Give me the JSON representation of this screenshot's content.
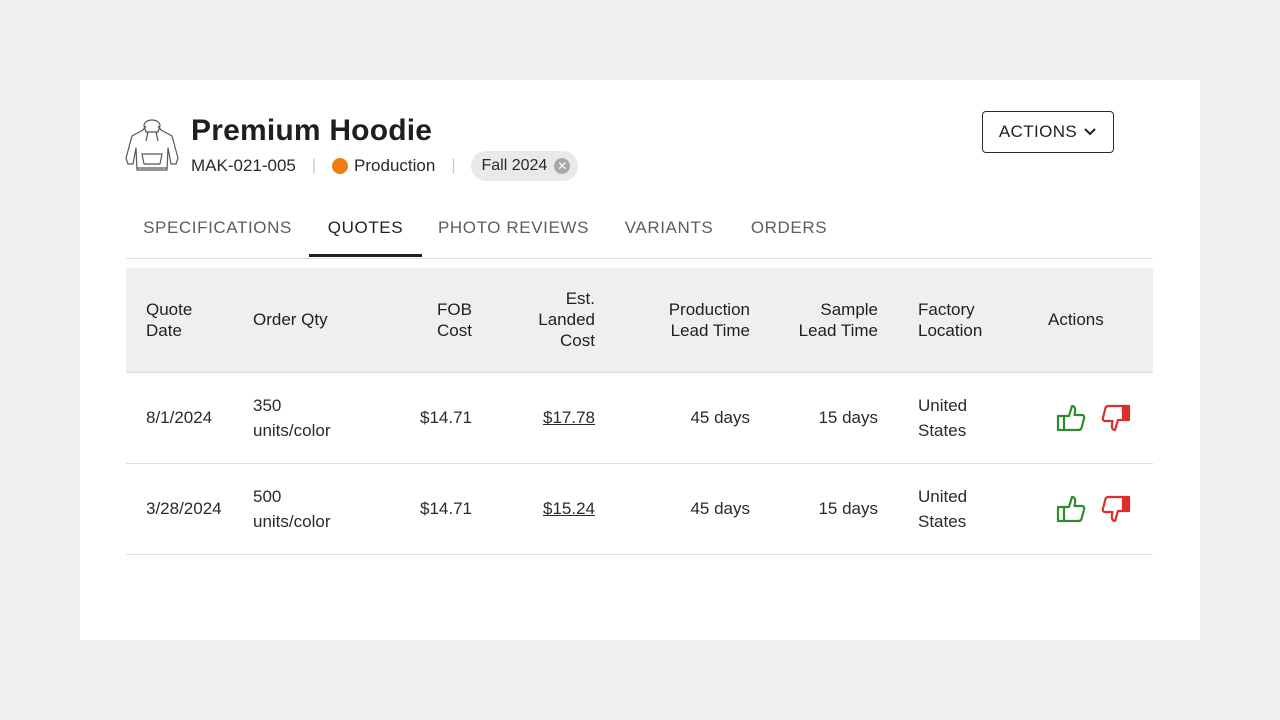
{
  "product": {
    "title": "Premium Hoodie",
    "sku": "MAK-021-005",
    "status": "Production",
    "status_color": "#f07c12",
    "season_tag": "Fall 2024",
    "thumbnail_icon": "hoodie-sketch-icon"
  },
  "header": {
    "actions_label": "ACTIONS"
  },
  "tabs": [
    {
      "label": "SPECIFICATIONS",
      "active": false
    },
    {
      "label": "QUOTES",
      "active": true
    },
    {
      "label": "PHOTO REVIEWS",
      "active": false
    },
    {
      "label": "VARIANTS",
      "active": false
    },
    {
      "label": "ORDERS",
      "active": false
    }
  ],
  "quotes_table": {
    "columns": [
      {
        "line1": "Quote",
        "line2": "Date",
        "line3": ""
      },
      {
        "line1": "Order Qty",
        "line2": "",
        "line3": ""
      },
      {
        "line1": "FOB",
        "line2": "Cost",
        "line3": ""
      },
      {
        "line1": "Est.",
        "line2": "Landed",
        "line3": "Cost"
      },
      {
        "line1": "Production",
        "line2": "Lead Time",
        "line3": ""
      },
      {
        "line1": "Sample",
        "line2": "Lead Time",
        "line3": ""
      },
      {
        "line1": "Factory",
        "line2": "Location",
        "line3": ""
      },
      {
        "line1": "Actions",
        "line2": "",
        "line3": ""
      }
    ],
    "rows": [
      {
        "quote_date": "8/1/2024",
        "order_qty_1": "350",
        "order_qty_2": "units/color",
        "fob_cost": "$14.71",
        "landed_cost": "$17.78",
        "production_lead_time": "45 days",
        "sample_lead_time": "15 days",
        "location_1": "United",
        "location_2": "States"
      },
      {
        "quote_date": "3/28/2024",
        "order_qty_1": "500",
        "order_qty_2": "units/color",
        "fob_cost": "$14.71",
        "landed_cost": "$15.24",
        "production_lead_time": "45 days",
        "sample_lead_time": "15 days",
        "location_1": "United",
        "location_2": "States"
      }
    ],
    "approve_icon": "thumbs-up-icon",
    "approve_color": "#2e8b2e",
    "reject_icon": "thumbs-down-icon",
    "reject_color": "#d9302b"
  }
}
